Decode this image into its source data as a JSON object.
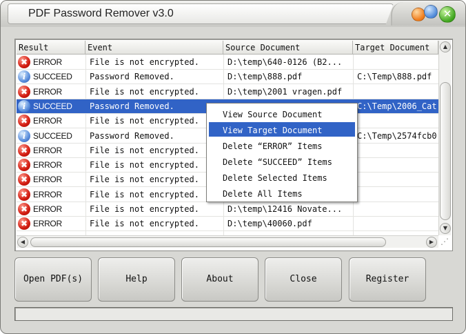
{
  "window": {
    "title": "PDF Password Remover v3.0"
  },
  "listview": {
    "columns": [
      "Result",
      "Event",
      "Source Document",
      "Target Document"
    ],
    "rows": [
      {
        "result": "ERROR",
        "status": "error",
        "event": "File is not encrypted.",
        "source": "D:\\temp\\640-0126  (B2...",
        "target": ""
      },
      {
        "result": "SUCCEED",
        "status": "info",
        "event": "Password Removed.",
        "source": "D:\\temp\\888.pdf",
        "target": "C:\\Temp\\888.pdf"
      },
      {
        "result": "ERROR",
        "status": "error",
        "event": "File is not encrypted.",
        "source": "D:\\temp\\2001 vragen.pdf",
        "target": ""
      },
      {
        "result": "SUCCEED",
        "status": "info",
        "event": "Password Removed.",
        "source": "",
        "target": "C:\\Temp\\2006_Cat",
        "selected": true
      },
      {
        "result": "ERROR",
        "status": "error",
        "event": "File is not encrypted.",
        "source": "",
        "target": ""
      },
      {
        "result": "SUCCEED",
        "status": "info",
        "event": "Password Removed.",
        "source": "",
        "target": "C:\\Temp\\2574fcb0"
      },
      {
        "result": "ERROR",
        "status": "error",
        "event": "File is not encrypted.",
        "source": "",
        "target": ""
      },
      {
        "result": "ERROR",
        "status": "error",
        "event": "File is not encrypted.",
        "source": "",
        "target": ""
      },
      {
        "result": "ERROR",
        "status": "error",
        "event": "File is not encrypted.",
        "source": "",
        "target": ""
      },
      {
        "result": "ERROR",
        "status": "error",
        "event": "File is not encrypted.",
        "source": "",
        "target": ""
      },
      {
        "result": "ERROR",
        "status": "error",
        "event": "File is not encrypted.",
        "source": "D:\\temp\\12416 Novate...",
        "target": ""
      },
      {
        "result": "ERROR",
        "status": "error",
        "event": "File is not encrypted.",
        "source": "D:\\temp\\40060.pdf",
        "target": ""
      }
    ]
  },
  "context_menu": {
    "items": [
      {
        "label": "View Source Document"
      },
      {
        "label": "View Target Document",
        "highlighted": true
      },
      {
        "label": "Delete “ERROR” Items"
      },
      {
        "label": "Delete “SUCCEED” Items"
      },
      {
        "label": "Delete Selected Items"
      },
      {
        "label": "Delete All Items"
      }
    ]
  },
  "buttons": {
    "open": "Open PDF(s)",
    "help": "Help",
    "about": "About",
    "close": "Close",
    "register": "Register"
  },
  "icons": {
    "error": "error-icon",
    "info": "info-icon",
    "error_glyph": "✖",
    "info_glyph": "i"
  },
  "colors": {
    "selection": "#3163c6",
    "error": "#d21b10",
    "info": "#5b8fdd"
  }
}
